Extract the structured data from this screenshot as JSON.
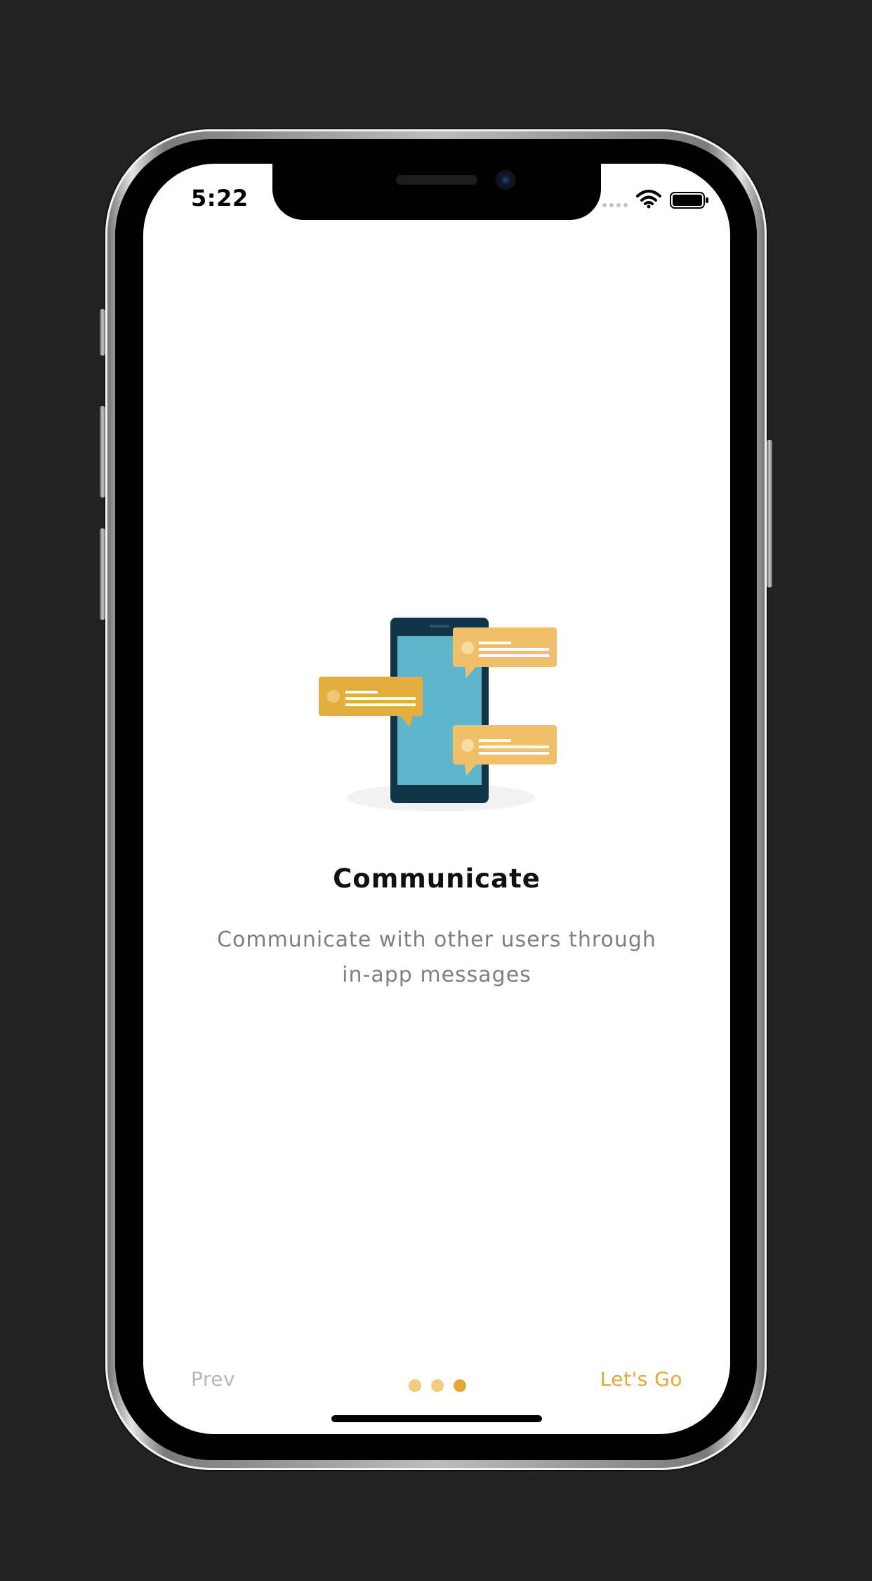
{
  "status_bar": {
    "time": "5:22",
    "icons": [
      "signal-dots-icon",
      "wifi-icon",
      "battery-icon"
    ]
  },
  "onboarding": {
    "illustration": "phone-chat-bubbles-illustration",
    "title": "Communicate",
    "description": "Communicate with other users through in-app messages"
  },
  "navigation": {
    "prev_label": "Prev",
    "next_label": "Let's Go",
    "page_count": 3,
    "current_page": 3
  },
  "colors": {
    "background": "#222222",
    "screen": "#ffffff",
    "accent": "#e4a83a",
    "accent_light": "#f2cc7c",
    "muted_text": "#b7b7b7",
    "phone_dark": "#123447",
    "phone_screen": "#5fb6cc",
    "bubble_dark": "#e4ae3e",
    "bubble_light": "#efbf6a"
  }
}
